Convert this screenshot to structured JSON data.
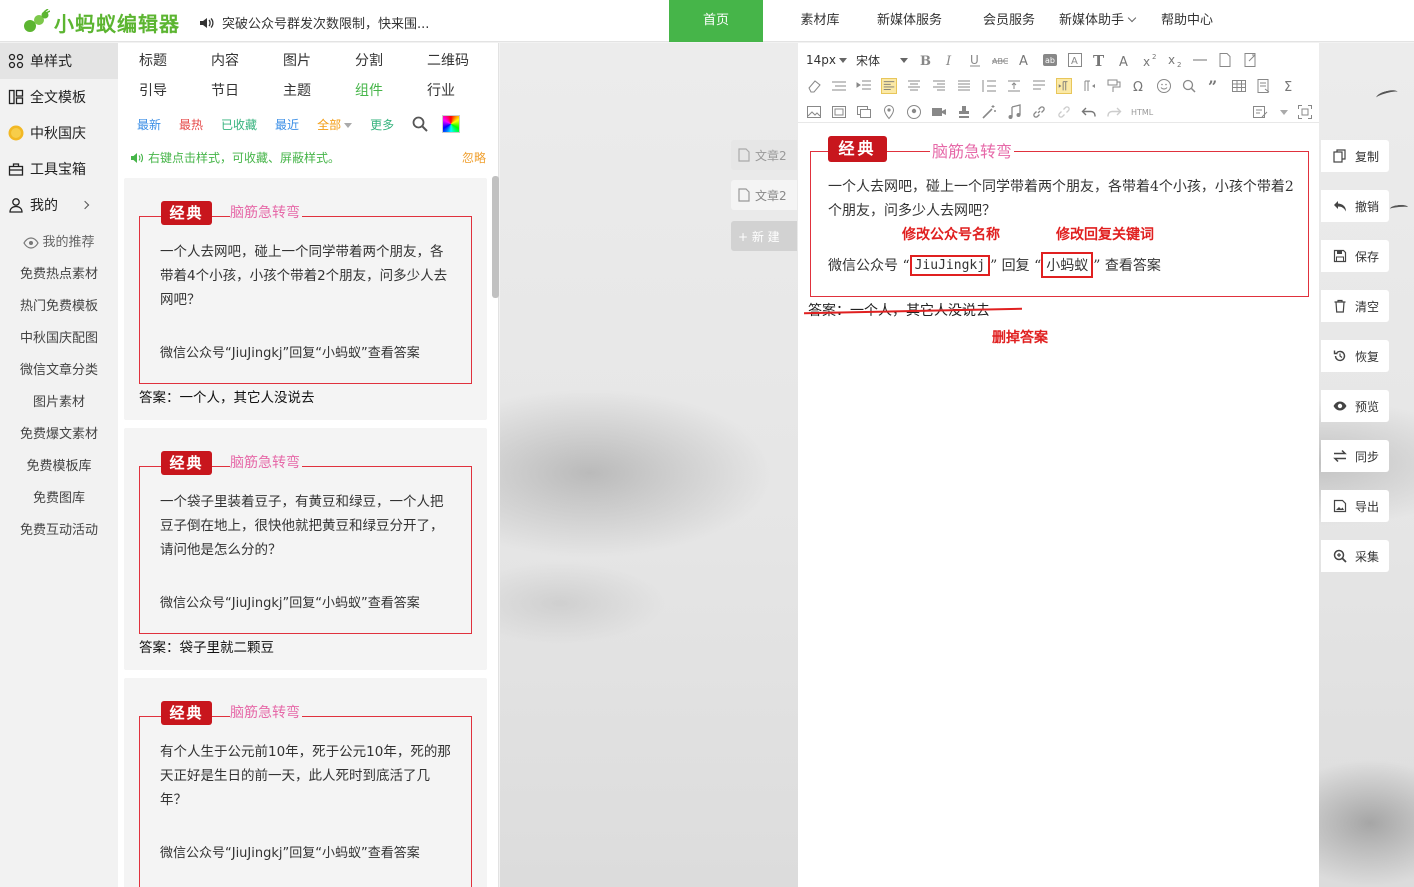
{
  "header": {
    "logo_text": "小蚂蚁编辑器",
    "notice": "突破公众号群发次数限制，快来围...",
    "nav": [
      {
        "label": "首页",
        "active": true
      },
      {
        "label": "素材库"
      },
      {
        "label": "新媒体服务"
      },
      {
        "label": "会员服务"
      },
      {
        "label": "新媒体助手"
      },
      {
        "label": "帮助中心"
      }
    ]
  },
  "categories": {
    "main": [
      {
        "label": "单样式",
        "icon": "grid-icon"
      },
      {
        "label": "全文模板",
        "icon": "template-icon"
      },
      {
        "label": "中秋国庆",
        "icon": "mooncake-icon"
      },
      {
        "label": "工具宝箱",
        "icon": "toolbox-icon"
      },
      {
        "label": "我的",
        "icon": "user-icon"
      }
    ],
    "sub": [
      "我的推荐",
      "免费热点素材",
      "热门免费模板",
      "中秋国庆配图",
      "微信文章分类",
      "图片素材",
      "免费爆文素材",
      "免费模板库",
      "免费图库",
      "免费互动活动"
    ]
  },
  "style_panel": {
    "tabs": [
      "标题",
      "内容",
      "图片",
      "分割",
      "二维码",
      "引导",
      "节日",
      "主题",
      "组件",
      "行业"
    ],
    "filters": [
      "最新",
      "最热",
      "已收藏",
      "最近",
      "全部",
      "更多"
    ],
    "tip": "右键点击样式，可收藏、屏蔽样式。",
    "ignore": "忽略",
    "cards": [
      {
        "badge": "经典",
        "title": "脑筋急转弯",
        "question": "一个人去网吧，碰上一个同学带着两个朋友，各带着4个小孩，小孩个带着2个朋友，问多少人去网吧？",
        "ref": "微信公众号“JiuJingkj”回复“小蚂蚁”查看答案",
        "answer": "答案：一个人，其它人没说去"
      },
      {
        "badge": "经典",
        "title": "脑筋急转弯",
        "question": "一个袋子里装着豆子，有黄豆和绿豆，一个人把豆子倒在地上，很快他就把黄豆和绿豆分开了，请问他是怎么分的？",
        "ref": "微信公众号“JiuJingkj”回复“小蚂蚁”查看答案",
        "answer": "答案：袋子里就二颗豆"
      },
      {
        "badge": "经典",
        "title": "脑筋急转弯",
        "question": "有个人生于公元前10年，死于公元10年，死的那天正好是生日的前一天，此人死时到底活了几年？",
        "ref": "微信公众号“JiuJingkj”回复“小蚂蚁”查看答案",
        "answer": ""
      }
    ]
  },
  "doc_buttons": [
    "文章2",
    "文章2",
    "+ 新 建"
  ],
  "editor": {
    "font_size": "14px",
    "font_family": "宋体",
    "html_label": "HTML",
    "badge": "经典",
    "title": "脑筋急转弯",
    "question": "一个人去网吧，碰上一个同学带着两个朋友，各带着4个小孩，小孩个带着2个朋友，问多少人去网吧？",
    "ref_prefix": "微信公众号 “",
    "ref_account": "JiuJingkj",
    "ref_mid": "” 回复 “",
    "ref_keyword": "小蚂蚁",
    "ref_suffix": "” 查看答案",
    "answer": "答案：一个人，其它人没说去",
    "annotations": {
      "account": "修改公众号名称",
      "keyword": "修改回复关键词",
      "delete": "删掉答案"
    }
  },
  "right_actions": [
    "复制",
    "撤销",
    "保存",
    "清空",
    "恢复",
    "预览",
    "同步",
    "导出",
    "采集"
  ],
  "colors": {
    "brand_green": "#46b549",
    "badge_red": "#c8161d",
    "title_pink": "#e669a8",
    "annotation_red": "#e02020"
  }
}
